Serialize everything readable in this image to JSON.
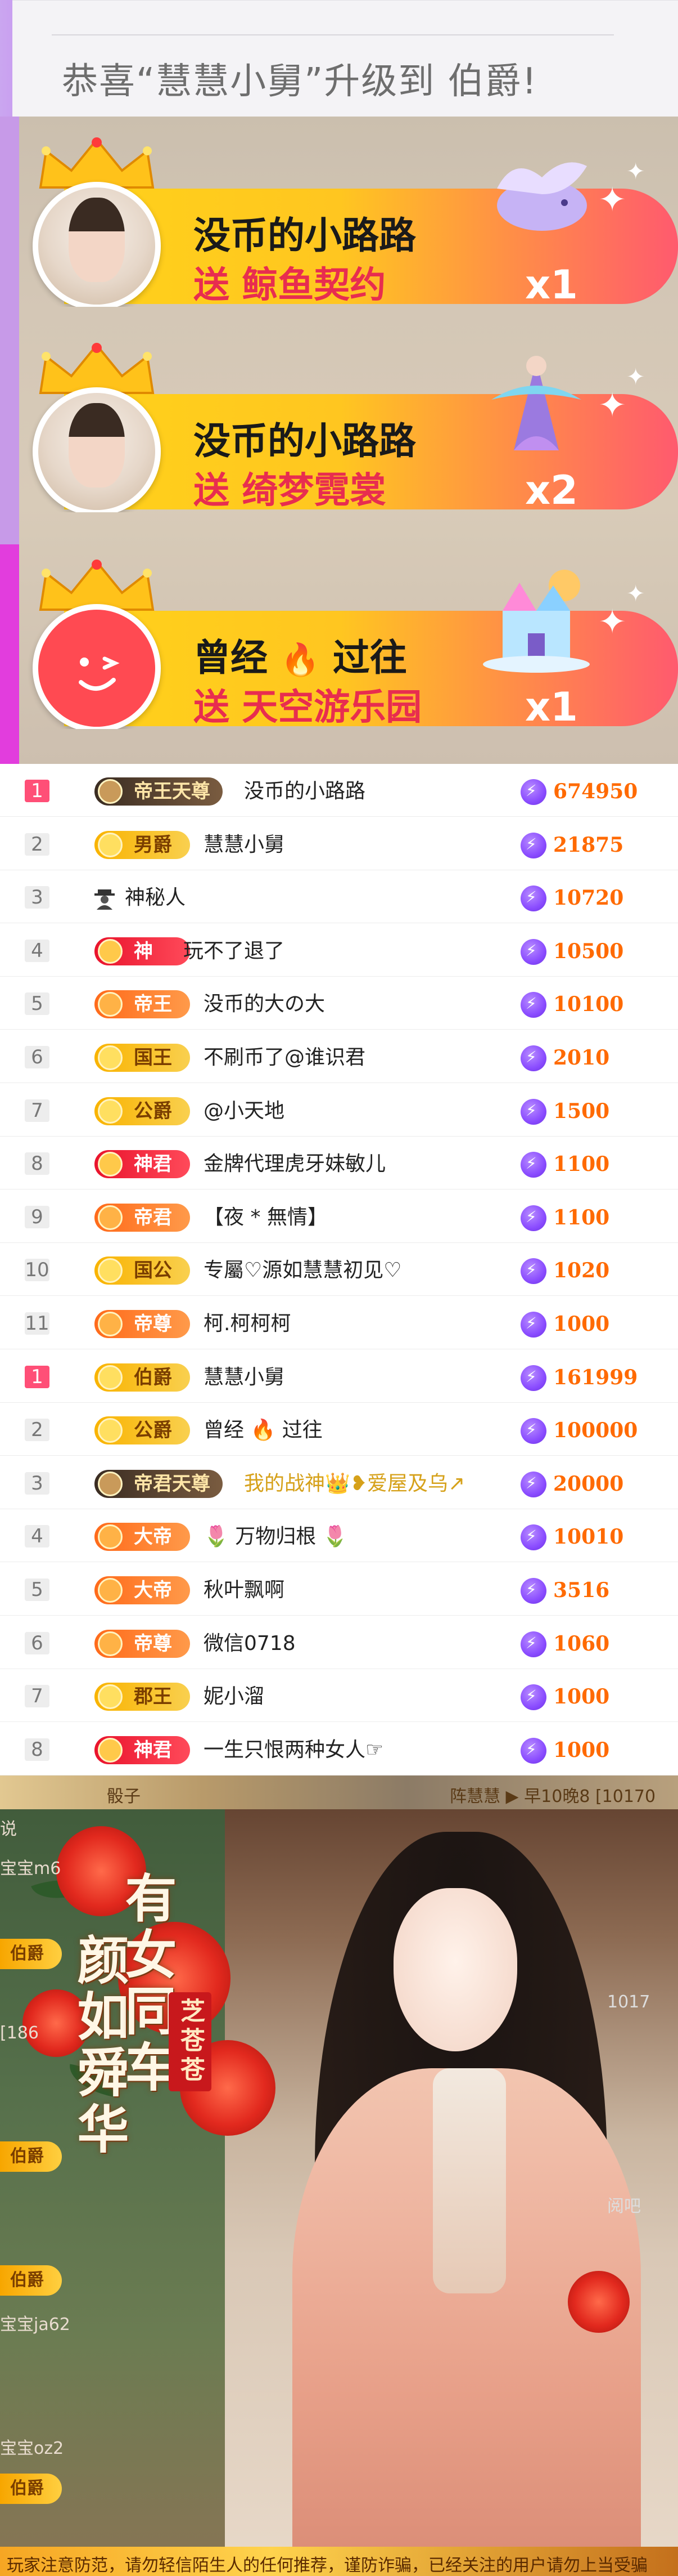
{
  "announcement": {
    "text": "恭喜“慧慧小舅”升级到 伯爵!"
  },
  "gift_banners": [
    {
      "sender": "没币的小路路",
      "gift": "送 鲸鱼契约",
      "count": "x1",
      "gift_icon": "whale-gift-icon",
      "avatar_type": "photo"
    },
    {
      "sender": "没币的小路路",
      "gift": "送 绮梦霓裳",
      "count": "x2",
      "gift_icon": "fairy-dress-gift-icon",
      "avatar_type": "photo"
    },
    {
      "sender_part1": "曾经",
      "sender_part2": "过往",
      "sender_emoji": "🔥",
      "gift": "送 天空游乐园",
      "count": "x1",
      "gift_icon": "sky-castle-gift-icon",
      "avatar_type": "smiley"
    }
  ],
  "ranking_colors": {
    "accent_value": "#ff6a00",
    "rank_top": "#ff4f77",
    "coin": "#8a4cff"
  },
  "ranking_1": [
    {
      "rank": "1",
      "badge": "帝王天尊",
      "badge_style": "dark",
      "name": "没币的小路路",
      "value": "674950"
    },
    {
      "rank": "2",
      "badge": "男爵",
      "badge_style": "gold",
      "name": "慧慧小舅",
      "value": "21875"
    },
    {
      "rank": "3",
      "badge": "",
      "badge_style": "mystery",
      "name": "神秘人",
      "value": "10720"
    },
    {
      "rank": "4",
      "badge": "神",
      "badge_style": "red",
      "name": "玩不了退了",
      "value": "10500"
    },
    {
      "rank": "5",
      "badge": "帝王",
      "badge_style": "orange",
      "name": "没币的大の大",
      "value": "10100"
    },
    {
      "rank": "6",
      "badge": "国王",
      "badge_style": "gold",
      "name": "不刷币了@谁识君",
      "value": "2010"
    },
    {
      "rank": "7",
      "badge": "公爵",
      "badge_style": "gold",
      "name": "@小天地",
      "value": "1500"
    },
    {
      "rank": "8",
      "badge": "神君",
      "badge_style": "red",
      "name": "金牌代理虎牙妹敏儿",
      "value": "1100"
    },
    {
      "rank": "9",
      "badge": "帝君",
      "badge_style": "orange",
      "name": "【夜 * 無情】",
      "value": "1100"
    },
    {
      "rank": "10",
      "badge": "国公",
      "badge_style": "gold",
      "name": "专屬♡源如慧慧初见♡",
      "value": "1020"
    },
    {
      "rank": "11",
      "badge": "帝尊",
      "badge_style": "orange",
      "name": "柯.柯柯柯",
      "value": "1000"
    }
  ],
  "ranking_2": [
    {
      "rank": "1",
      "badge": "伯爵",
      "badge_style": "gold",
      "name": "慧慧小舅",
      "value": "161999"
    },
    {
      "rank": "2",
      "badge": "公爵",
      "badge_style": "gold",
      "name": "曾经 🔥 过往",
      "value": "100000"
    },
    {
      "rank": "3",
      "badge": "帝君天尊",
      "badge_style": "dark",
      "name": "我的战神👑❥爱屋及乌↗",
      "value": "20000"
    },
    {
      "rank": "4",
      "badge": "大帝",
      "badge_style": "orange",
      "name": "🌷 万物归根 🌷",
      "value": "10010"
    },
    {
      "rank": "5",
      "badge": "大帝",
      "badge_style": "orange",
      "name": "秋叶飘啊",
      "value": "3516"
    },
    {
      "rank": "6",
      "badge": "帝尊",
      "badge_style": "orange",
      "name": "微信0718",
      "value": "1060"
    },
    {
      "rank": "7",
      "badge": "郡王",
      "badge_style": "gold",
      "name": "妮小溜",
      "value": "1000"
    },
    {
      "rank": "8",
      "badge": "神君",
      "badge_style": "red",
      "name": "一生只恨两种女人☞",
      "value": "1000"
    }
  ],
  "poster": {
    "top_strip_left": "骰子",
    "top_strip_right": "阵慧慧 ▶ 早10晚8 [10170",
    "title_left": "颜如舜华",
    "title_right": "有女同车",
    "seal": "芝苍苍",
    "side_chips": [
      "伯爵",
      "伯爵",
      "伯爵",
      "伯爵"
    ],
    "side_texts_left": [
      "说",
      "宝宝m6",
      "[186",
      "宝宝ja62",
      "宝宝oz2"
    ],
    "side_text_right_1": "1017",
    "side_text_right_2": "阅吧",
    "bottom_text": "玩家注意防范，请勿轻信陌生人的任何推荐，谨防诈骗，已经关注的用户请勿上当受骗"
  }
}
